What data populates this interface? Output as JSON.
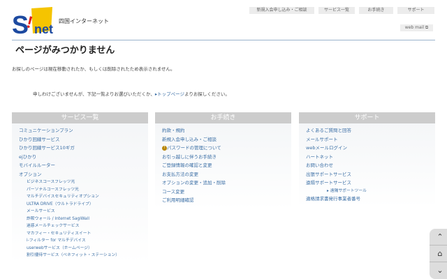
{
  "header": {
    "logo_text": "S!net",
    "brand": "四国インターネット",
    "nav": [
      "新規入会申し込み・ご相談",
      "サービス一覧",
      "お手続き",
      "サポート"
    ],
    "webmail": "web mail ⧉"
  },
  "main": {
    "title": "ページがみつかりません",
    "message": "お探しのページは現在移動されたか、もしくは削除されたため表示されません。",
    "guide_before": "申しわけございませんが、下記一覧よりお選びいただくか、",
    "guide_link": "▸トップページ",
    "guide_after": "よりお探しください。"
  },
  "columns": [
    {
      "title": "サービス一覧",
      "items": [
        {
          "label": "コミュニケーションプラン",
          "level": 0
        },
        {
          "label": "ひかり回線サービス",
          "level": 0
        },
        {
          "label": "ひかり回線サービス10ギガ",
          "level": 0
        },
        {
          "label": "ejひかり",
          "level": 0
        },
        {
          "label": "モバイルルーター",
          "level": 0
        },
        {
          "label": "オプション",
          "level": 0
        },
        {
          "label": "ビジネスコースフレッツ光",
          "level": 1
        },
        {
          "label": "パーソナルコースフレッツ光",
          "level": 1
        },
        {
          "label": "マルチデバイスセキュリティオプション",
          "level": 1
        },
        {
          "label": "ULTRA DRIVE（ウルトラドライブ）",
          "level": 1
        },
        {
          "label": "メールサービス",
          "level": 1
        },
        {
          "label": "詐欺ウォール / Internet SagiWall",
          "level": 1
        },
        {
          "label": "迷惑メールチェックサービス",
          "level": 1
        },
        {
          "label": "マカフィー・セキュリティスイート",
          "level": 1
        },
        {
          "label": "i-フィルター for マルチデバイス",
          "level": 1
        },
        {
          "label": "userwebサービス（ホームページ）",
          "level": 1
        },
        {
          "label": "割引優待サービス（ベネフィット・ステーション）",
          "level": 1
        }
      ]
    },
    {
      "title": "お手続き",
      "items": [
        {
          "label": "約款・規約",
          "level": 0
        },
        {
          "label": "新規入会申し込み・ご相談",
          "level": 0
        },
        {
          "label": "パスワードの管理について",
          "level": 0,
          "icon": "!"
        },
        {
          "label": "お引っ越しに伴うお手続き",
          "level": 0
        },
        {
          "label": "ご登録情報の確認と変更",
          "level": 0
        },
        {
          "label": "お支払方法の変更",
          "level": 0
        },
        {
          "label": "オプションの変更・追加・削除",
          "level": 0
        },
        {
          "label": "コース変更",
          "level": 0
        },
        {
          "label": "ご利用明細確認",
          "level": 0
        }
      ]
    },
    {
      "title": "サポート",
      "items": [
        {
          "label": "よくあるご質問と回答",
          "level": 0
        },
        {
          "label": "メールサポート",
          "level": 0
        },
        {
          "label": "webメールログイン",
          "level": 0
        },
        {
          "label": "ハートネット",
          "level": 0
        },
        {
          "label": "お問い合わせ",
          "level": 0
        },
        {
          "label": "出張サポートサービス",
          "level": 0
        },
        {
          "label": "遠隔サポートサービス",
          "level": 0
        },
        {
          "label": "▸ 遠隔サポートツール",
          "level": 2
        },
        {
          "label": "適格請求書発行事業者番号",
          "level": 0
        }
      ]
    }
  ],
  "sidenav": {
    "up": "⌃",
    "home": "⌂",
    "down": "⌄"
  },
  "colors": {
    "link": "#3a6ea5",
    "header_gray": "#cccccc",
    "rule": "#9ab3cc"
  }
}
